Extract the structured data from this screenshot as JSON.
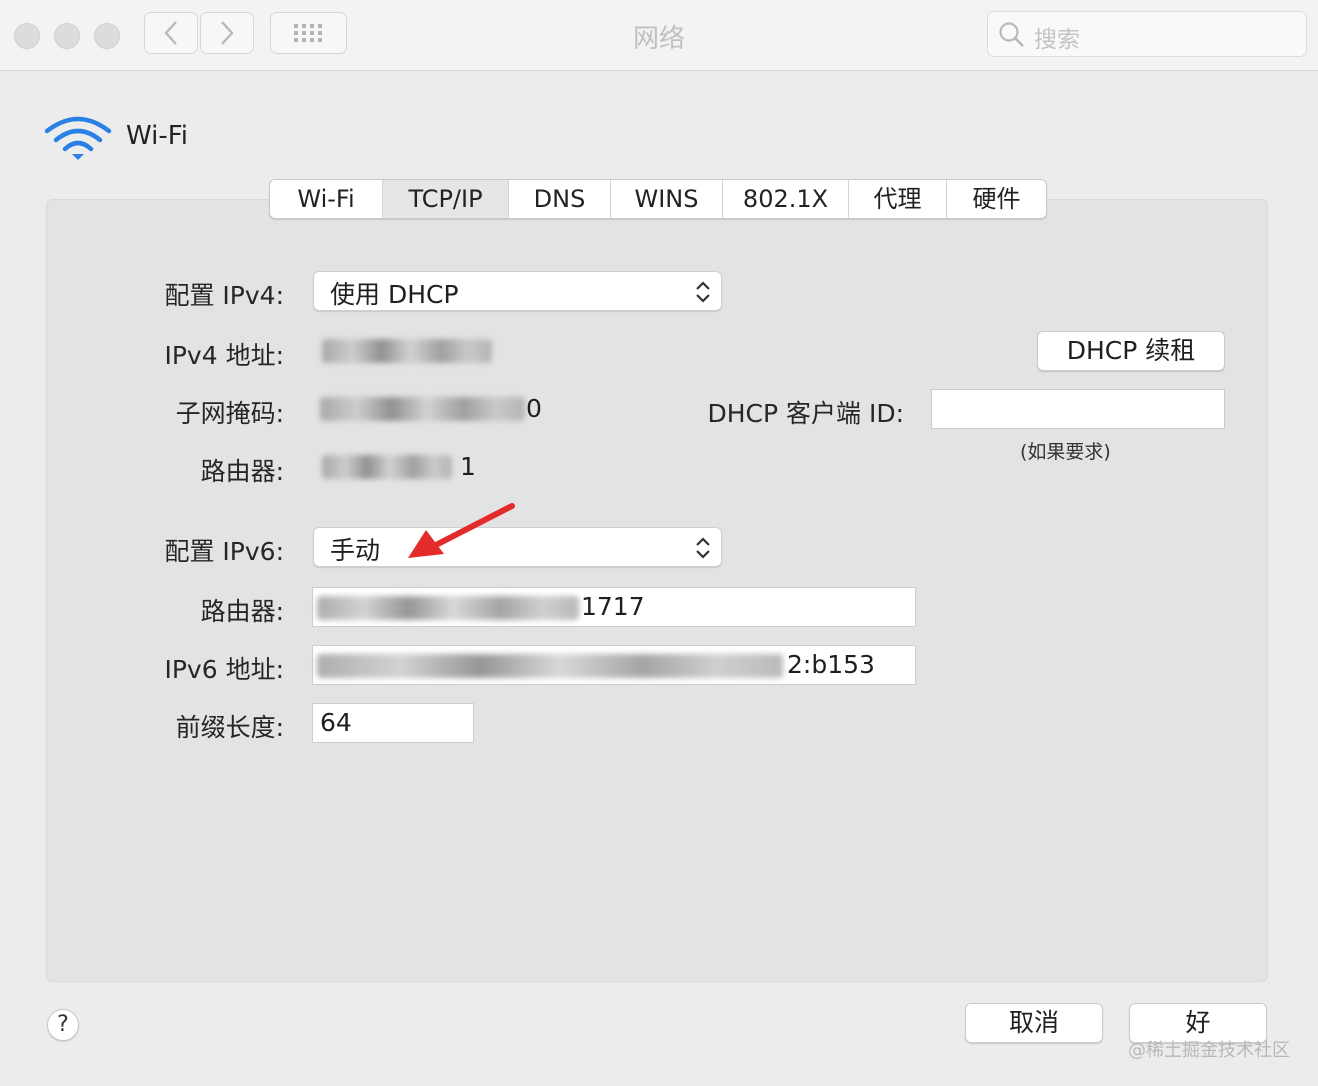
{
  "window": {
    "title": "网络"
  },
  "search": {
    "placeholder": "搜索"
  },
  "header": {
    "title": "Wi-Fi"
  },
  "tabs": [
    {
      "label": "Wi-Fi",
      "selected": false
    },
    {
      "label": "TCP/IP",
      "selected": true
    },
    {
      "label": "DNS",
      "selected": false
    },
    {
      "label": "WINS",
      "selected": false
    },
    {
      "label": "802.1X",
      "selected": false
    },
    {
      "label": "代理",
      "selected": false
    },
    {
      "label": "硬件",
      "selected": false
    }
  ],
  "ipv4": {
    "configure_label": "配置 IPv4:",
    "configure_value": "使用 DHCP",
    "address_label": "IPv4 地址:",
    "subnet_label": "子网掩码:",
    "subnet_visible_tail": "0",
    "router_label": "路由器:",
    "router_visible_tail": "1"
  },
  "dhcp": {
    "renew_button": "DHCP 续租",
    "client_id_label": "DHCP 客户端 ID:",
    "client_id_value": "",
    "client_id_hint": "(如果要求)"
  },
  "ipv6": {
    "configure_label": "配置 IPv6:",
    "configure_value": "手动",
    "router_label": "路由器:",
    "router_visible_tail": "1717",
    "address_label": "IPv6 地址:",
    "address_visible_tail": "2:b153",
    "prefix_label": "前缀长度:",
    "prefix_value": "64"
  },
  "footer": {
    "help": "?",
    "cancel_button": "取消",
    "ok_button": "好"
  },
  "watermark": "@稀土掘金技术社区",
  "colors": {
    "wifi_icon": "#2b80e6",
    "annotation_arrow": "#e32b2b"
  }
}
